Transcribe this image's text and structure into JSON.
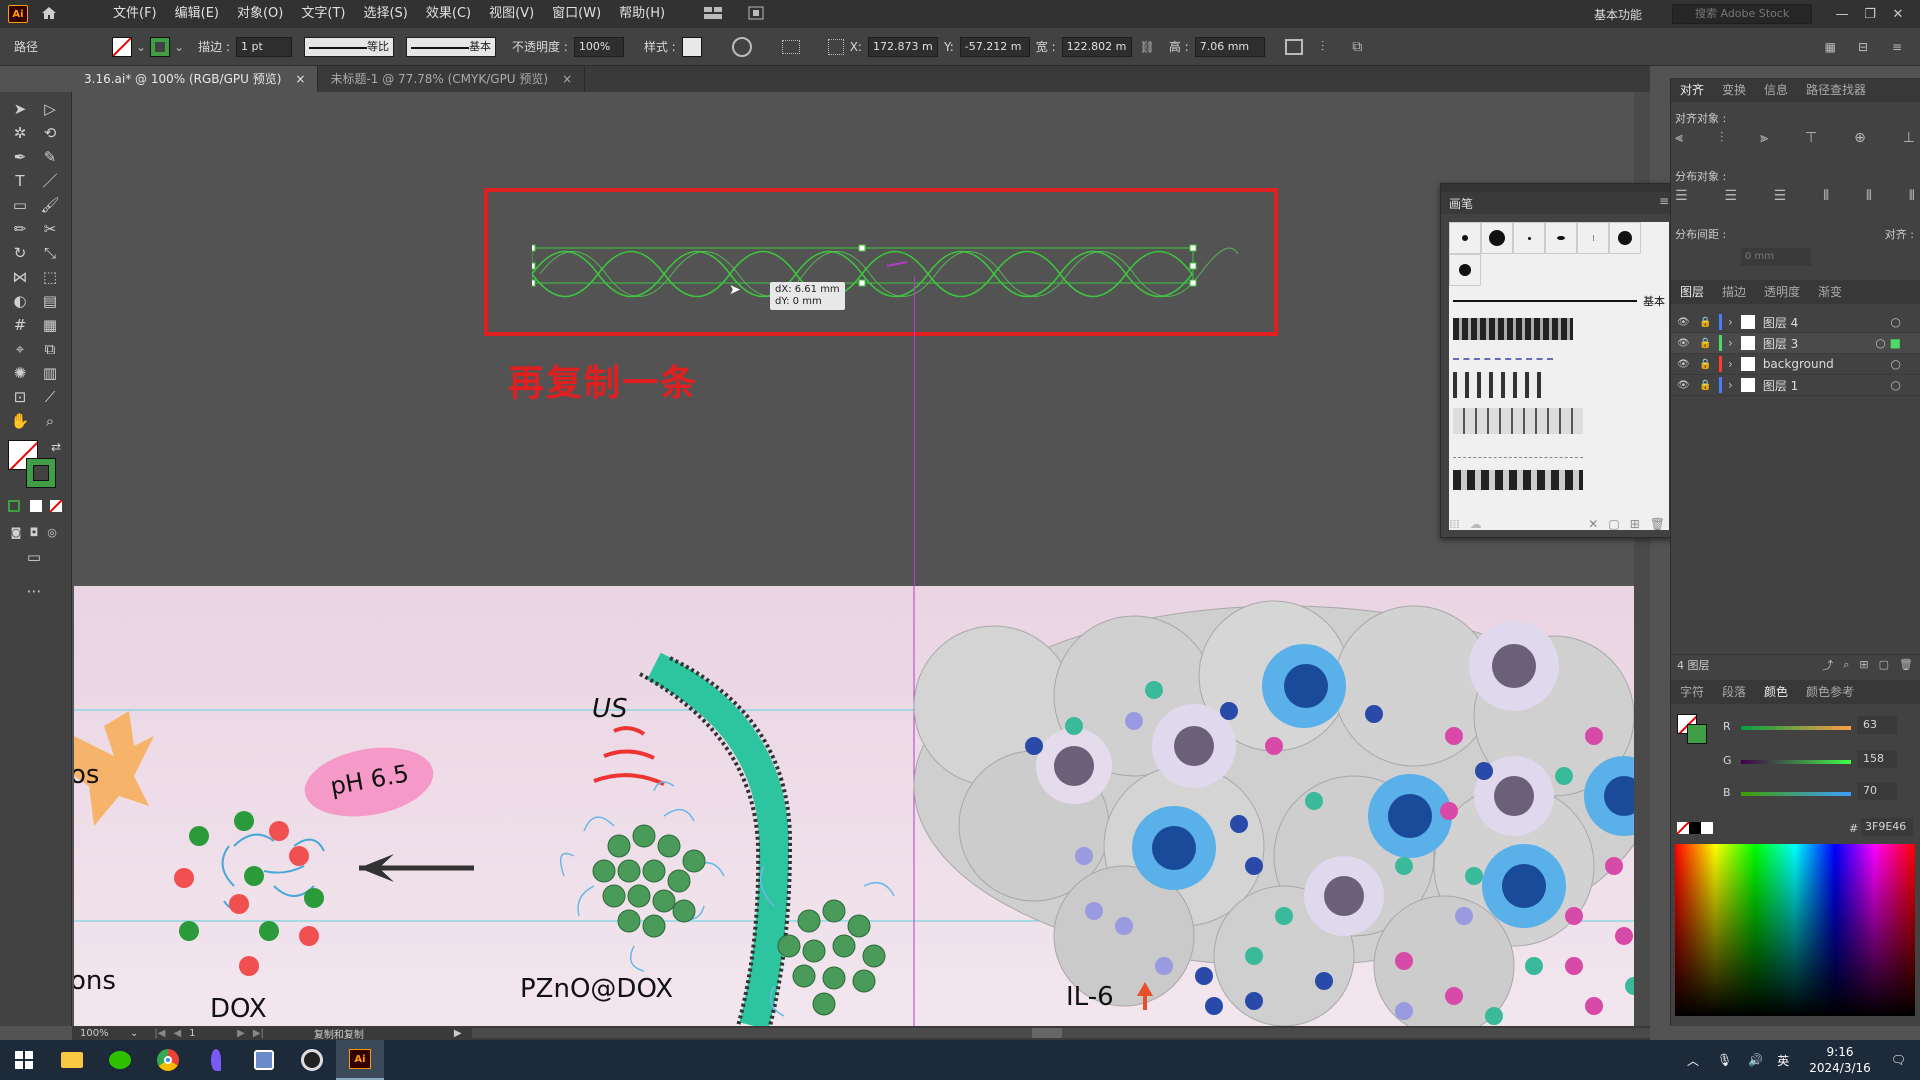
{
  "app": {
    "logo": "Ai",
    "menu": [
      "文件(F)",
      "编辑(E)",
      "对象(O)",
      "文字(T)",
      "选择(S)",
      "效果(C)",
      "视图(V)",
      "窗口(W)",
      "帮助(H)"
    ],
    "workspace": "基本功能",
    "search_placeholder": "搜索 Adobe Stock"
  },
  "control_bar": {
    "selection_type": "路径",
    "stroke_label": "描边 :",
    "stroke_weight": "1 pt",
    "profile_label": "等比",
    "brush_label": "基本",
    "opacity_label": "不透明度 :",
    "opacity_value": "100%",
    "style_label": "样式 :",
    "x_label": "X:",
    "x_value": "172.873 m",
    "y_label": "Y:",
    "y_value": "-57.212 m",
    "w_label": "宽 :",
    "w_value": "122.802 m",
    "h_label": "高 :",
    "h_value": "7.06 mm"
  },
  "tabs": [
    {
      "label": "3.16.ai* @ 100% (RGB/GPU 预览)",
      "active": true
    },
    {
      "label": "未标题-1 @ 77.78% (CMYK/GPU 预览)",
      "active": false
    }
  ],
  "canvas": {
    "annotation": "再复制一条",
    "tooltip_dx": "dX: 6.61 mm",
    "tooltip_dy": "dY: 0 mm",
    "labels": {
      "ph": "pH 6.5",
      "us": "US",
      "pzno": "PZnO@DOX",
      "dox": "DOX",
      "ons": "ons",
      "os": "os",
      "il6": "IL-6"
    }
  },
  "brush_panel": {
    "title": "画笔",
    "basic_label": "基本"
  },
  "align_panel": {
    "tabs": [
      "对齐",
      "变换",
      "信息",
      "路径查找器"
    ],
    "align_objects": "对齐对象 :",
    "distribute_objects": "分布对象 :",
    "distribute_spacing": "分布间距 :",
    "align_to": "对齐 :",
    "spacing_value": "0 mm"
  },
  "layers_panel": {
    "tabs": [
      "图层",
      "描边",
      "透明度",
      "渐变"
    ],
    "layers": [
      {
        "name": "图层 4",
        "color": "#4a7bff"
      },
      {
        "name": "图层 3",
        "color": "#4cd964"
      },
      {
        "name": "background",
        "color": "#ff3b30"
      },
      {
        "name": "图层 1",
        "color": "#4a7bff"
      }
    ],
    "count": "4 图层"
  },
  "color_panel": {
    "tabs": [
      "字符",
      "段落",
      "颜色",
      "颜色参考"
    ],
    "r_label": "R",
    "r_value": "63",
    "g_label": "G",
    "g_value": "158",
    "b_label": "B",
    "b_value": "70",
    "hex_label": "#",
    "hex_value": "3F9E46",
    "color": "#3F9E46"
  },
  "status_bar": {
    "zoom": "100%",
    "artboard": "1",
    "status": "复制和复制"
  },
  "taskbar": {
    "time": "9:16",
    "date": "2024/3/16",
    "ime": "英"
  },
  "colors": {
    "accent_red": "#e02020",
    "selection_green": "#3cc83c",
    "guide_cyan": "#5fd3e0",
    "guide_magenta": "#b43cc8"
  }
}
